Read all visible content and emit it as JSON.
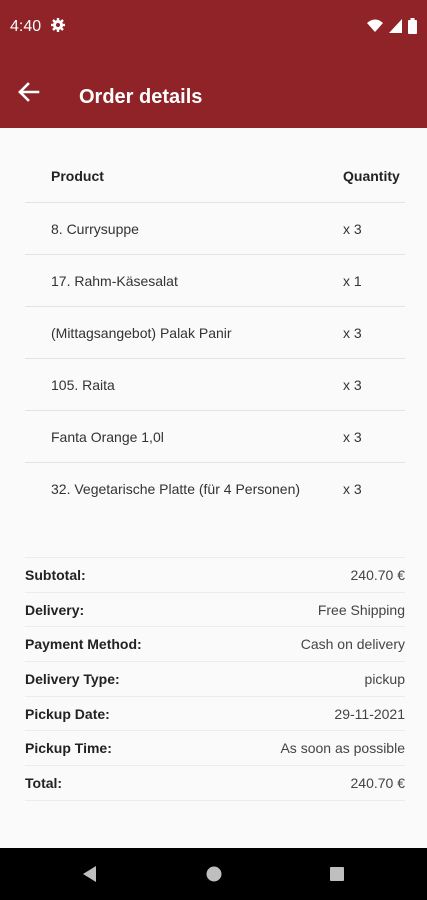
{
  "status": {
    "time": "4:40"
  },
  "appbar": {
    "title": "Order details"
  },
  "products": {
    "header": {
      "product": "Product",
      "quantity": "Quantity"
    },
    "items": [
      {
        "name": "8. Currysuppe",
        "qty": "x 3"
      },
      {
        "name": "17. Rahm-Käsesalat",
        "qty": "x 1"
      },
      {
        "name": "(Mittagsangebot) Palak Panir",
        "qty": "x 3"
      },
      {
        "name": "105. Raita",
        "qty": "x 3"
      },
      {
        "name": "Fanta Orange 1,0l",
        "qty": "x 3"
      },
      {
        "name": "32. Vegetarische Platte (für 4 Personen)",
        "qty": "x 3"
      }
    ]
  },
  "summary": [
    {
      "label": "Subtotal:",
      "value": "240.70 €"
    },
    {
      "label": "Delivery:",
      "value": "Free Shipping"
    },
    {
      "label": "Payment Method:",
      "value": "Cash on delivery"
    },
    {
      "label": "Delivery Type:",
      "value": "pickup"
    },
    {
      "label": "Pickup Date:",
      "value": "29-11-2021"
    },
    {
      "label": "Pickup Time:",
      "value": "As soon as possible"
    },
    {
      "label": "Total:",
      "value": "240.70 €"
    }
  ],
  "colors": {
    "primary": "#8f2328"
  },
  "icons": {
    "status": [
      "gear-icon",
      "wifi-icon",
      "signal-icon",
      "battery-icon"
    ],
    "appbar": "back-arrow-icon",
    "nav": [
      "nav-back-icon",
      "nav-home-icon",
      "nav-recents-icon"
    ]
  }
}
